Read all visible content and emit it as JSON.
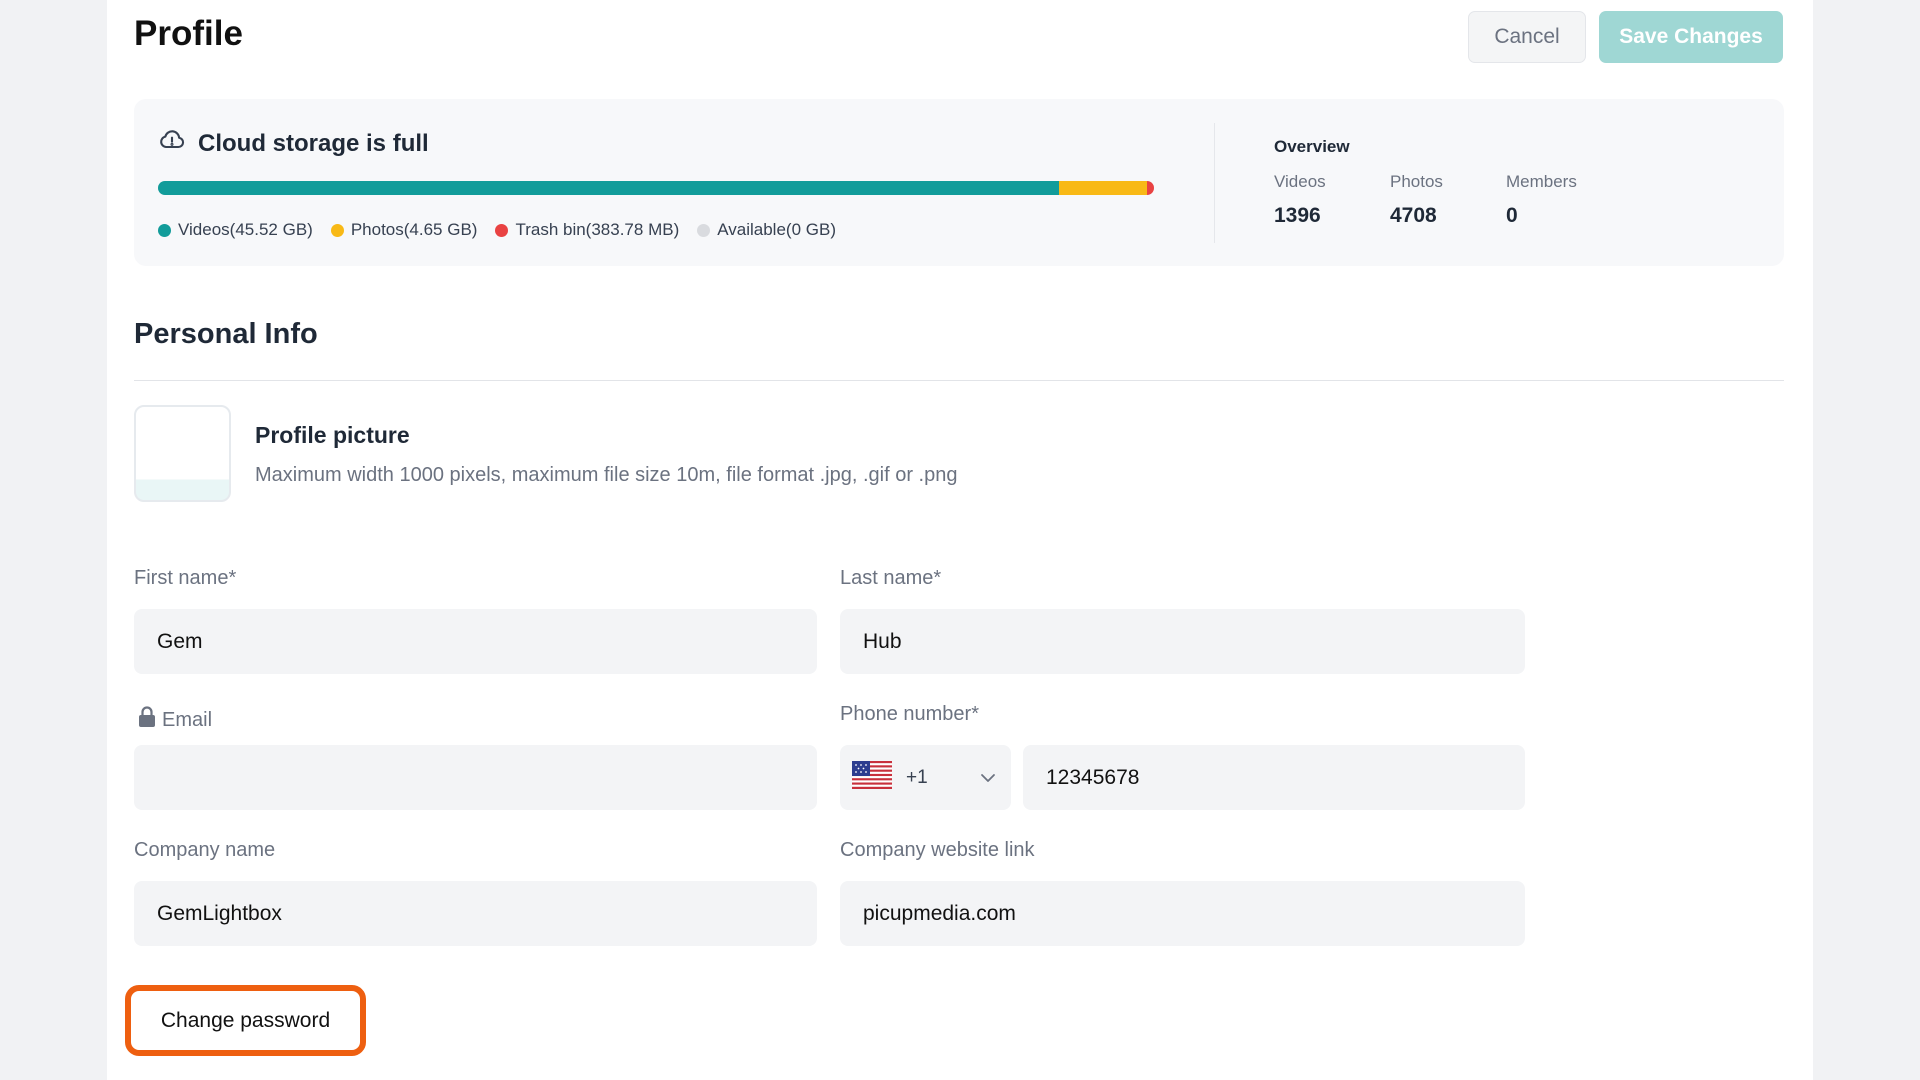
{
  "header": {
    "title": "Profile",
    "cancel_label": "Cancel",
    "save_label": "Save Changes"
  },
  "storage": {
    "title": "Cloud storage is full",
    "icon": "cloud-alert-icon",
    "usage": [
      {
        "label": "Videos(45.52 GB)",
        "fraction": 0.905,
        "color": "#129c9a"
      },
      {
        "label": "Photos(4.65 GB)",
        "fraction": 0.088,
        "color": "#f8b916"
      },
      {
        "label": "Trash bin(383.78 MB)",
        "fraction": 0.007,
        "color": "#e94242"
      },
      {
        "label": "Available(0 GB)",
        "fraction": 0.0,
        "color": "#d9dbdf"
      }
    ],
    "overview": {
      "title": "Overview",
      "stats": [
        {
          "label": "Videos",
          "value": "1396"
        },
        {
          "label": "Photos",
          "value": "4708"
        },
        {
          "label": "Members",
          "value": "0"
        }
      ]
    }
  },
  "personal_info": {
    "title": "Personal Info",
    "profile_picture": {
      "title": "Profile picture",
      "description": "Maximum width 1000 pixels, maximum file size 10m, file format .jpg, .gif or .png"
    },
    "fields": {
      "first_name": {
        "label": "First name*",
        "value": "Gem"
      },
      "last_name": {
        "label": "Last name*",
        "value": "Hub"
      },
      "email": {
        "label": "Email",
        "value": "",
        "icon": "lock-icon"
      },
      "phone": {
        "label": "Phone number*",
        "country_code": "+1",
        "flag": "us-flag-icon",
        "value": "12345678"
      },
      "company_name": {
        "label": "Company name",
        "value": "GemLightbox"
      },
      "company_website": {
        "label": "Company website link",
        "value": "picupmedia.com"
      }
    },
    "change_password_label": "Change password"
  }
}
